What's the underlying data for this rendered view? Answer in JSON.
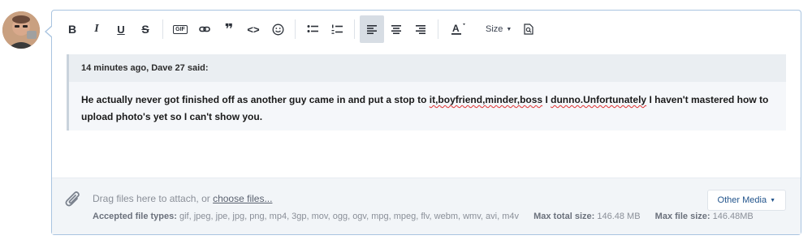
{
  "toolbar": {
    "bold": "B",
    "italic": "I",
    "underline": "U",
    "strike": "S",
    "gif": "GIF",
    "quote": "❞",
    "code": "<>",
    "size_label": "Size"
  },
  "quote": {
    "header": "14 minutes ago, Dave 27 said:",
    "body_pre": "He actually never got finished off as another guy came in and put a stop to ",
    "body_sp1": "it,boyfriend,minder,boss",
    "body_mid": " I ",
    "body_sp2": "dunno.Unfortunately",
    "body_post": " I haven't mastered how to upload photo's yet so I can't show you."
  },
  "attachments": {
    "drag_text": "Drag files here to attach, or ",
    "choose_link": "choose files...",
    "accepted_label": "Accepted file types:",
    "accepted_types": "gif, jpeg, jpe, jpg, png, mp4, 3gp, mov, ogg, ogv, mpg, mpeg, flv, webm, wmv, avi, m4v",
    "max_total_label": "Max total size:",
    "max_total_value": "146.48 MB",
    "max_file_label": "Max file size:",
    "max_file_value": "146.48MB",
    "other_media": "Other Media"
  },
  "colors": {
    "editor_border": "#a9c4e0",
    "link_blue": "#23558c",
    "spell_error": "#e03030"
  },
  "icons": [
    "bold-icon",
    "italic-icon",
    "underline-icon",
    "strikethrough-icon",
    "gif-icon",
    "link-icon",
    "quote-icon",
    "code-icon",
    "emoji-icon",
    "bullet-list-icon",
    "numbered-list-icon",
    "align-left-icon",
    "align-center-icon",
    "align-right-icon",
    "text-color-icon",
    "font-size-dropdown",
    "preview-icon",
    "paperclip-icon"
  ]
}
